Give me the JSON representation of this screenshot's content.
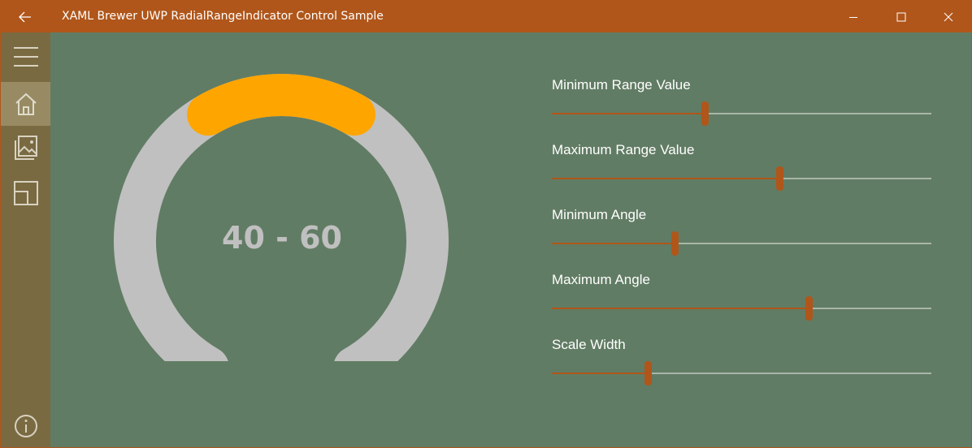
{
  "window": {
    "title": "XAML Brewer UWP RadialRangeIndicator Control Sample"
  },
  "titlebar_icons": {
    "back": "back-arrow-icon",
    "minimize": "minimize-icon",
    "maximize": "maximize-icon",
    "close": "close-icon"
  },
  "sidebar": {
    "items": [
      {
        "name": "hamburger-menu",
        "icon": "hamburger-icon",
        "selected": false
      },
      {
        "name": "home",
        "icon": "home-icon",
        "selected": true
      },
      {
        "name": "gallery",
        "icon": "gallery-icon",
        "selected": false
      },
      {
        "name": "layout",
        "icon": "layout-icon",
        "selected": false
      }
    ],
    "footer": {
      "name": "info",
      "icon": "info-icon"
    }
  },
  "gauge": {
    "label": "40 - 60",
    "range_min": 40,
    "range_max": 60,
    "min_angle": -150,
    "max_angle": 150,
    "scale_color": "#c0c0c0",
    "range_color": "#ffa500"
  },
  "sliders": [
    {
      "label": "Minimum Range Value",
      "value_fraction": 0.402
    },
    {
      "label": "Maximum Range Value",
      "value_fraction": 0.599
    },
    {
      "label": "Minimum Angle",
      "value_fraction": 0.323
    },
    {
      "label": "Maximum Angle",
      "value_fraction": 0.677
    },
    {
      "label": "Scale Width",
      "value_fraction": 0.253
    }
  ],
  "colors": {
    "accent": "#b0561a",
    "content_bg": "#617c64",
    "sidebar_bg": "#7a6a42",
    "sidebar_selected": "#988b64"
  }
}
